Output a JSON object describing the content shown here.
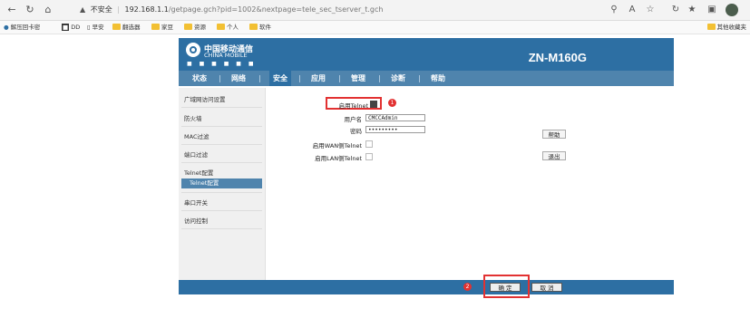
{
  "browser": {
    "url_warning": "不安全",
    "url_host": "192.168.1.1",
    "url_path": "/getpage.gch?pid=1002&nextpage=tele_sec_tserver_t.gch",
    "bookmarks": [
      "解压回卡密",
      "DD",
      "早安",
      "翻选器",
      "家豆",
      "资源",
      "个人",
      "软件"
    ],
    "bookmarks_right": "其他收藏夹"
  },
  "header": {
    "brand_cn": "中国移动通信",
    "brand_en": "CHINA MOBILE",
    "brand_dots": "■ ■ ■ ■ ■ ■",
    "model": "ZN-M160G"
  },
  "menu": {
    "items": [
      "状态",
      "网络",
      "安全",
      "应用",
      "管理",
      "诊断",
      "帮助"
    ],
    "active": "安全",
    "separator": "|"
  },
  "sidebar": {
    "items": [
      "广域网访问设置",
      "防火墙",
      "MAC过滤",
      "端口过滤",
      "Telnet配置",
      "串口开关",
      "访问控制"
    ],
    "sub_item": "Telnet配置"
  },
  "form": {
    "enable_telnet_label": "启用Telnet",
    "enable_telnet_checked": true,
    "username_label": "用户名",
    "username_value": "CMCCAdmin",
    "password_label": "密码",
    "password_value": "•••••••••",
    "wan_telnet_label": "启用WAN侧Telnet",
    "lan_telnet_label": "启用LAN侧Telnet",
    "help_button": "帮助",
    "logout_button": "退出"
  },
  "footer": {
    "confirm_button": "确 定",
    "cancel_button": "取 消"
  },
  "annotations": {
    "badge_1": "1",
    "badge_2": "2"
  },
  "colors": {
    "header_blue": "#2d6fa3",
    "menu_blue": "#4f84ad",
    "annotation_red": "#e23232"
  }
}
